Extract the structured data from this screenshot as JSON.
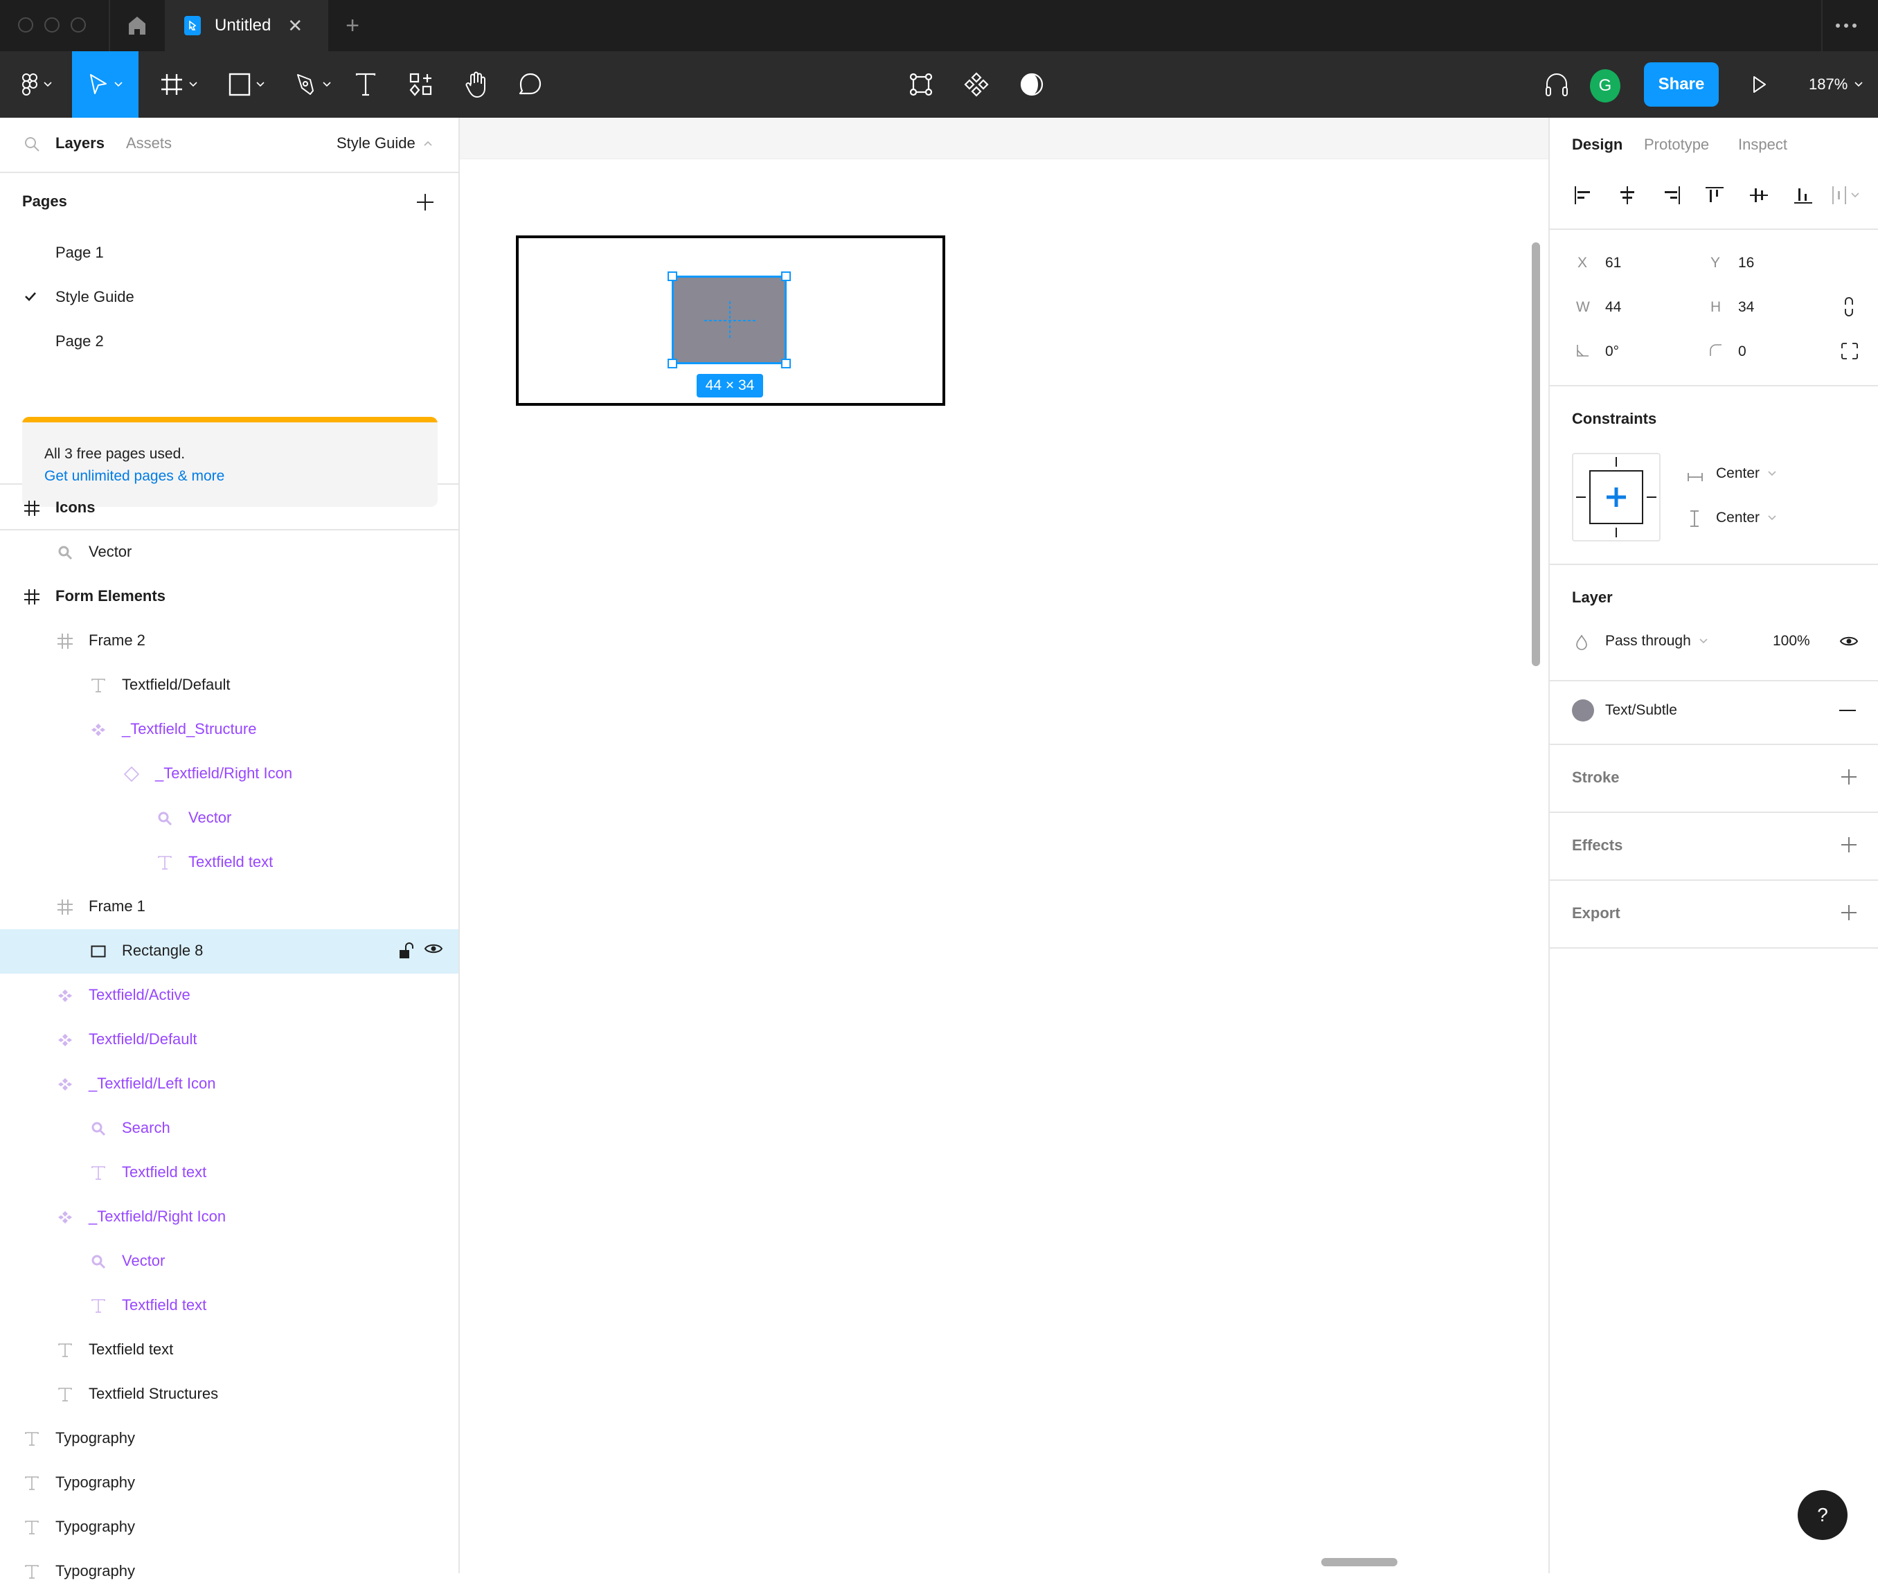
{
  "window": {
    "tab_title": "Untitled",
    "new_tab_label": "+",
    "close_tab_glyph": "✕"
  },
  "toolbar": {
    "tools": [
      {
        "name": "main-menu",
        "icon": "figma-logo-icon"
      },
      {
        "name": "move-tool",
        "icon": "cursor-arrow-icon",
        "active": true
      },
      {
        "name": "frame-tool",
        "icon": "frame-hash-icon"
      },
      {
        "name": "shape-tool",
        "icon": "rectangle-icon"
      },
      {
        "name": "pen-tool",
        "icon": "pen-icon"
      },
      {
        "name": "text-tool",
        "icon": "text-t-icon"
      },
      {
        "name": "resources-tool",
        "icon": "resources-icon"
      },
      {
        "name": "hand-tool",
        "icon": "hand-icon"
      },
      {
        "name": "comment-tool",
        "icon": "comment-bubble-icon"
      }
    ],
    "center_tools": [
      {
        "name": "edit-object",
        "icon": "vector-edit-icon"
      },
      {
        "name": "create-component",
        "icon": "component-icon"
      },
      {
        "name": "mask",
        "icon": "mask-contrast-icon"
      }
    ],
    "avatar_initial": "G",
    "share_label": "Share",
    "zoom_level": "187%",
    "accent_color": "#0d99ff"
  },
  "left_panel": {
    "tabs": {
      "layers": "Layers",
      "assets": "Assets"
    },
    "current_page": "Style Guide",
    "pages_title": "Pages",
    "pages": [
      {
        "label": "Page 1",
        "selected": false
      },
      {
        "label": "Style Guide",
        "selected": true
      },
      {
        "label": "Page 2",
        "selected": false
      }
    ],
    "upgrade": {
      "message": "All 3 free pages used.",
      "link": "Get unlimited pages & more"
    },
    "layers": [
      {
        "label": "Icons",
        "type": "frame",
        "depth": 0,
        "bold": true
      },
      {
        "label": "Vector",
        "type": "vector",
        "depth": 1
      },
      {
        "label": "Form Elements",
        "type": "frame",
        "depth": 0,
        "bold": true
      },
      {
        "label": "Frame 2",
        "type": "frame",
        "depth": 1
      },
      {
        "label": "Textfield/Default",
        "type": "text",
        "depth": 2
      },
      {
        "label": "_Textfield_Structure",
        "type": "component",
        "depth": 2
      },
      {
        "label": "_Textfield/Right Icon",
        "type": "instance",
        "depth": 3
      },
      {
        "label": "Vector",
        "type": "vector",
        "depth": 4,
        "component_child": true
      },
      {
        "label": "Textfield text",
        "type": "text",
        "depth": 4,
        "component_child": true
      },
      {
        "label": "Frame 1",
        "type": "frame",
        "depth": 1
      },
      {
        "label": "Rectangle 8",
        "type": "rectangle",
        "depth": 2,
        "selected": true
      },
      {
        "label": "Textfield/Active",
        "type": "component",
        "depth": 1
      },
      {
        "label": "Textfield/Default",
        "type": "component",
        "depth": 1
      },
      {
        "label": "_Textfield/Left Icon",
        "type": "component",
        "depth": 1
      },
      {
        "label": "Search",
        "type": "vector",
        "depth": 2,
        "component_child": true
      },
      {
        "label": "Textfield text",
        "type": "text",
        "depth": 2,
        "component_child": true
      },
      {
        "label": "_Textfield/Right Icon",
        "type": "component",
        "depth": 1
      },
      {
        "label": "Vector",
        "type": "vector",
        "depth": 2,
        "component_child": true
      },
      {
        "label": "Textfield text",
        "type": "text",
        "depth": 2,
        "component_child": true
      },
      {
        "label": "Textfield text",
        "type": "text",
        "depth": 1
      },
      {
        "label": "Textfield Structures",
        "type": "text",
        "depth": 1
      },
      {
        "label": "Typography",
        "type": "text",
        "depth": 0
      },
      {
        "label": "Typography",
        "type": "text",
        "depth": 0
      },
      {
        "label": "Typography",
        "type": "text",
        "depth": 0
      },
      {
        "label": "Typography",
        "type": "text",
        "depth": 0
      }
    ],
    "component_color": "#9747ff",
    "selected_row_color": "#daf0fb"
  },
  "canvas": {
    "selection_size_label": "44 × 34",
    "rect_fill": "#8a8892"
  },
  "right_panel": {
    "tabs": [
      {
        "label": "Design",
        "active": true
      },
      {
        "label": "Prototype",
        "active": false
      },
      {
        "label": "Inspect",
        "active": false
      }
    ],
    "position": {
      "x_label": "X",
      "x": "61",
      "y_label": "Y",
      "y": "16",
      "w_label": "W",
      "w": "44",
      "h_label": "H",
      "h": "34",
      "rotation": "0°",
      "corner_radius": "0"
    },
    "constraints": {
      "title": "Constraints",
      "horizontal": "Center",
      "vertical": "Center"
    },
    "layer": {
      "title": "Layer",
      "blend_mode": "Pass through",
      "opacity": "100%"
    },
    "fill": {
      "style_name": "Text/Subtle",
      "swatch_color": "#8a8892"
    },
    "stroke_title": "Stroke",
    "effects_title": "Effects",
    "export_title": "Export"
  },
  "help_label": "?"
}
